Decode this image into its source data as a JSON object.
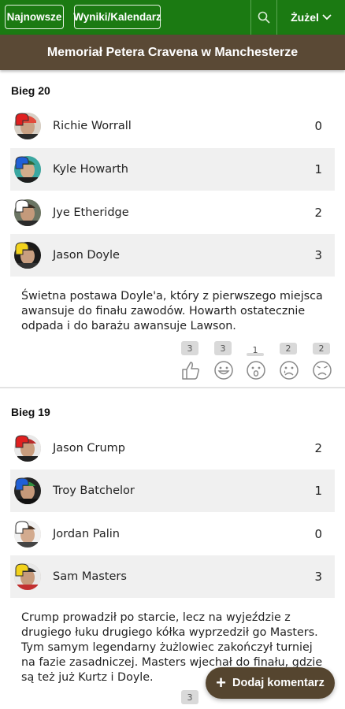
{
  "nav": {
    "latest_label": "Najnowsze",
    "results_label": "Wyniki/Kalendarz",
    "search_icon": "search-icon",
    "sport_label": "Żużel",
    "sport_icon": "chevron-down-icon",
    "bg_color": "#1b7a12"
  },
  "event": {
    "title": "Memoriał Petera Cravena w Manchesterze",
    "bg_color": "#5a4935"
  },
  "heats": [
    {
      "title": "Bieg 20",
      "riders": [
        {
          "name": "Richie Worrall",
          "points": "0",
          "helmet_color": "#e02020"
        },
        {
          "name": "Kyle Howarth",
          "points": "1",
          "helmet_color": "#1f5fd6"
        },
        {
          "name": "Jye Etheridge",
          "points": "2",
          "helmet_color": "#ffffff"
        },
        {
          "name": "Jason Doyle",
          "points": "3",
          "helmet_color": "#f2d21b"
        }
      ],
      "comment": "Świetna postawa Doyle'a, który z pierwszego miejsca awansuje do finału zawodów. Howarth ostatecznie odpada i do barażu awansuje Lawson.",
      "reactions": [
        {
          "icon": "thumbs-up-icon",
          "count": "3"
        },
        {
          "icon": "smile-icon",
          "count": "3"
        },
        {
          "icon": "surprised-icon",
          "count": "1"
        },
        {
          "icon": "crying-icon",
          "count": "2"
        },
        {
          "icon": "angry-icon",
          "count": "2"
        }
      ]
    },
    {
      "title": "Bieg 19",
      "riders": [
        {
          "name": "Jason Crump",
          "points": "2",
          "helmet_color": "#e02020"
        },
        {
          "name": "Troy Batchelor",
          "points": "1",
          "helmet_color": "#1f5fd6"
        },
        {
          "name": "Jordan Palin",
          "points": "0",
          "helmet_color": "#ffffff"
        },
        {
          "name": "Sam Masters",
          "points": "3",
          "helmet_color": "#f2d21b"
        }
      ],
      "comment": "Crump prowadził po starcie, lecz na wyjeździe z drugiego łuku drugiego kółka wyprzedził go Masters. Tym samym legendarny żużlowiec zakończył turniej na fazie zasadniczej. Masters wjechał do finału, gdzie są też już Kurtz i Doyle.",
      "reactions": [
        {
          "icon": "thumbs-up-icon",
          "count": "3"
        }
      ]
    }
  ],
  "fab": {
    "label": "Dodaj komentarz",
    "icon": "plus-icon",
    "bg_color": "#55452f"
  }
}
